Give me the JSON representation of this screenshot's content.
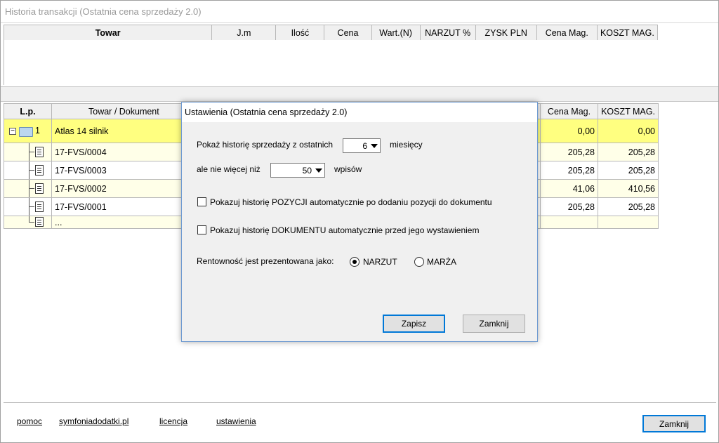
{
  "window": {
    "title": "Historia transakcji (Ostatnia cena sprzedaży 2.0)"
  },
  "top_grid": {
    "columns": [
      "Towar",
      "J.m",
      "Ilość",
      "Cena",
      "Wart.(N)",
      "NARZUT %",
      "ZYSK PLN",
      "Cena Mag.",
      "KOSZT MAG."
    ]
  },
  "history_grid": {
    "columns": [
      "L.p.",
      "Towar / Dokument",
      "Cena Mag.",
      "KOSZT MAG."
    ],
    "group": {
      "lp": "1",
      "name": "Atlas 14 silnik",
      "cena_mag": "0,00",
      "koszt_mag": "0,00"
    },
    "rows": [
      {
        "doc": "17-FVS/0004",
        "cena_mag": "205,28",
        "koszt_mag": "205,28"
      },
      {
        "doc": "17-FVS/0003",
        "cena_mag": "205,28",
        "koszt_mag": "205,28"
      },
      {
        "doc": "17-FVS/0002",
        "cena_mag": "41,06",
        "koszt_mag": "410,56"
      },
      {
        "doc": "17-FVS/0001",
        "cena_mag": "205,28",
        "koszt_mag": "205,28"
      }
    ],
    "more": "..."
  },
  "footer": {
    "links": [
      "pomoc",
      "symfoniadodatki.pl",
      "licencja",
      "ustawienia"
    ],
    "close_label": "Zamknij"
  },
  "dialog": {
    "title": "Ustawienia (Ostatnia cena sprzedaży 2.0)",
    "months_label": "Pokaż historię sprzedaży z ostatnich",
    "months_value": "6",
    "months_suffix": "miesięcy",
    "limit_label": "ale nie więcej niż",
    "limit_value": "50",
    "limit_suffix": "wpisów",
    "check_position": {
      "label": "Pokazuj historię POZYCJI automatycznie po dodaniu pozycji do dokumentu",
      "checked": false
    },
    "check_document": {
      "label": "Pokazuj historię DOKUMENTU automatycznie przed jego wystawieniem",
      "checked": false
    },
    "profit_label": "Rentowność jest prezentowana jako:",
    "radio_narzut": {
      "label": "NARZUT",
      "checked": true
    },
    "radio_marza": {
      "label": "MARŻA",
      "checked": false
    },
    "save_label": "Zapisz",
    "close_label": "Zamknij"
  }
}
